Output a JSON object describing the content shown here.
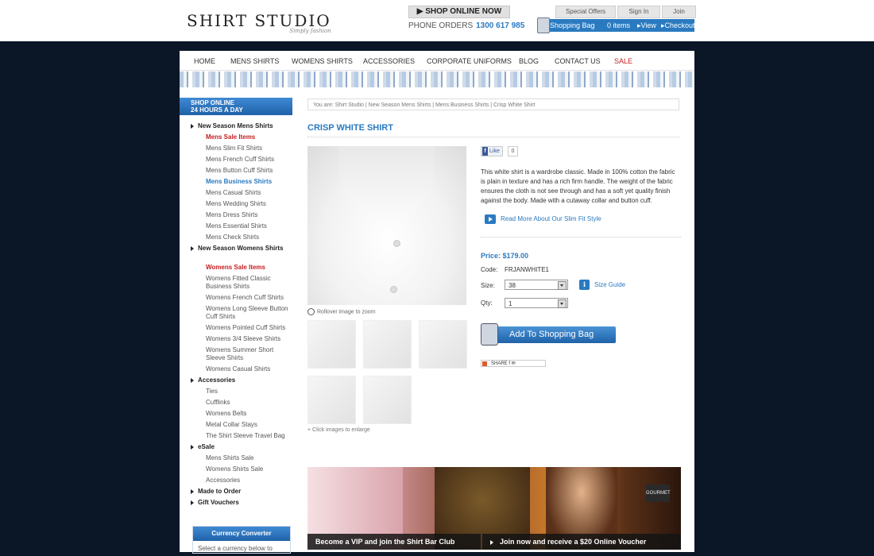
{
  "header": {
    "logo_text": "SHIRT STUDIO",
    "logo_tagline": "Simply fashion",
    "shop_online": "SHOP ONLINE NOW",
    "phone_label": "PHONE ORDERS",
    "phone_number": "1300 617 985",
    "links": [
      "Special Offers",
      "Sign In",
      "Join"
    ],
    "bag": {
      "label": "Shopping Bag",
      "items": "0 items",
      "view": "View",
      "checkout": "Checkout"
    }
  },
  "nav": [
    "HOME",
    "MENS SHIRTS",
    "WOMENS SHIRTS",
    "ACCESSORIES",
    "CORPORATE UNIFORMS",
    "BLOG",
    "CONTACT US",
    "SALE"
  ],
  "sidebar": {
    "shop_24_line1": "SHOP ONLINE",
    "shop_24_line2": "24 HOURS A DAY",
    "categories": [
      {
        "label": "New Season Mens Shirts",
        "items": [
          "Mens Sale Items",
          "Mens Slim Fit Shirts",
          "Mens French Cuff Shirts",
          "Mens Button Cuff Shirts",
          "Mens Business Shirts",
          "Mens Casual Shirts",
          "Mens Wedding Shirts",
          "Mens Dress Shirts",
          "Mens Essential Shirts",
          "Mens Check Shirts"
        ]
      },
      {
        "label": "New Season Womens Shirts",
        "items": [
          "Womens Sale Items",
          "Womens Fitted Classic Business Shirts",
          "Womens French Cuff Shirts",
          "Womens Long Sleeve Button Cuff Shirts",
          "Womens Pointed Cuff Shirts",
          "Womens 3/4 Sleeve Shirts",
          "Womens Summer Short Sleeve Shirts",
          "Womens Casual Shirts"
        ]
      },
      {
        "label": "Accessories",
        "items": [
          "Ties",
          "Cufflinks",
          "Womens Belts",
          "Metal Collar Stays",
          "The Shirt Sleeve Travel Bag"
        ]
      },
      {
        "label": "eSale",
        "items": [
          "Mens Shirts Sale",
          "Womens Shirts Sale",
          "Accessories"
        ]
      },
      {
        "label": "Made to Order",
        "items": []
      },
      {
        "label": "Gift Vouchers",
        "items": []
      }
    ],
    "currency_title": "Currency Converter",
    "currency_text": "Select a currency below to"
  },
  "breadcrumb": "You are: Shirt Studio | New Season Mens Shirts | Mens Business Shirts | Crisp White Shirt",
  "product": {
    "title": "CRISP WHITE SHIRT",
    "zoom_hint": "Rollover image to zoom",
    "enlarge_hint": "+ Click images to enlarge",
    "like_label": "Like",
    "like_count": "0",
    "description": "This white shirt is a wardrobe classic. Made in 100% cotton the fabric is plain in texture and has a rich firm handle. The weight of the fabric ensures the cloth is not see through and has a soft yet quality finish against the body. Made with a cutaway collar and button cuff.",
    "read_more": "Read More About Our Slim Fit Style",
    "price": "Price: $179.00",
    "code_label": "Code:",
    "code": "FRJANWHITE1",
    "size_label": "Size:",
    "size_value": "38",
    "size_guide": "Size Guide",
    "qty_label": "Qty:",
    "qty_value": "1",
    "add_to_bag": "Add To Shopping Bag",
    "share": "SHARE"
  },
  "banner": {
    "left": "Become a VIP and join the Shirt Bar Club",
    "right": "Join now and receive a $20 Online Voucher",
    "sign": "GOURMET"
  },
  "colors": {
    "accent": "#2a7ac0",
    "sale": "#c41e1e",
    "background": "#0b1626"
  }
}
